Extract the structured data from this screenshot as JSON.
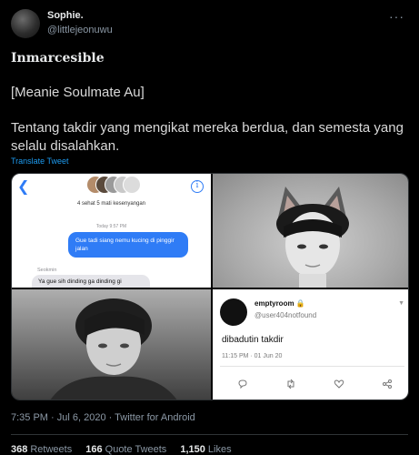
{
  "author": {
    "name": "Sophie.",
    "handle": "@littlejeonuwu"
  },
  "tweet": {
    "title": "Inmarcesible",
    "subtitle": "[Meanie Soulmate Au]",
    "text": "Tentang takdir yang mengikat mereka berdua, dan semesta yang selalu disalahkan.",
    "translate_label": "Translate Tweet",
    "meta": "7:35 PM · Jul 6, 2020 · Twitter for Android"
  },
  "media": {
    "chat": {
      "group_name": "4 sehat 5 mati kesenyangan",
      "time": "Today 9:57 PM",
      "outgoing": "Gue tadi siang nemu kucing di pinggir jalan",
      "sender": "Seokmin",
      "incoming": "Ya gue sih dinding ga dinding gi"
    },
    "embedded_tweet": {
      "name": "emptyroom",
      "handle": "@user404notfound",
      "text": "dibadutin takdir",
      "date": "11:15 PM · 01 Jun 20"
    }
  },
  "stats": {
    "retweets_count": "368",
    "retweets_label": "Retweets",
    "quotes_count": "166",
    "quotes_label": "Quote Tweets",
    "likes_count": "1,150",
    "likes_label": "Likes"
  },
  "colors": {
    "background": "#000000",
    "accent": "#1d9bf0",
    "imessage_blue": "#2f7cf6"
  },
  "icons": [
    "more-icon",
    "back-icon",
    "info-icon",
    "lock-icon",
    "chevron-down-icon",
    "reply-icon",
    "retweet-icon",
    "like-icon",
    "share-icon"
  ]
}
